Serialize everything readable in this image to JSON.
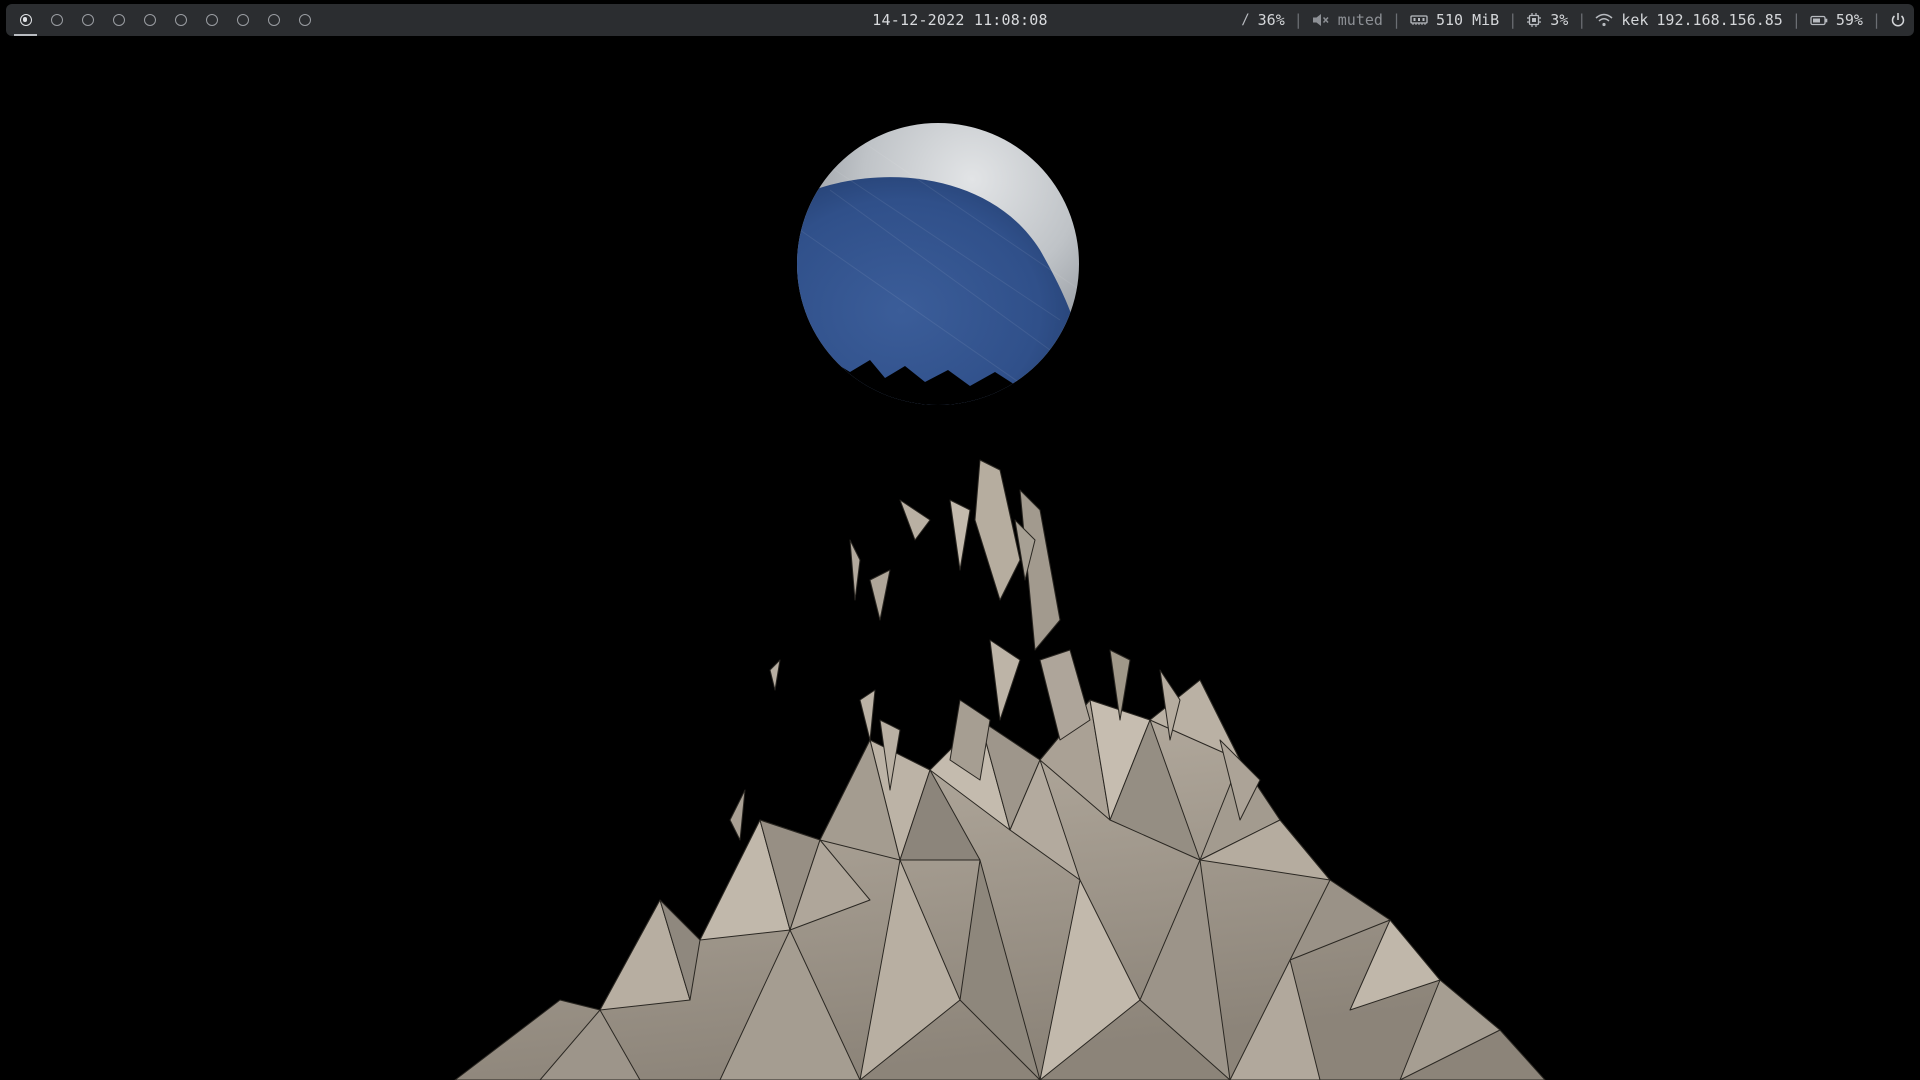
{
  "topbar": {
    "workspaces": [
      {
        "id": "1",
        "active": true
      },
      {
        "id": "2",
        "active": false
      },
      {
        "id": "3",
        "active": false
      },
      {
        "id": "4",
        "active": false
      },
      {
        "id": "5",
        "active": false
      },
      {
        "id": "6",
        "active": false
      },
      {
        "id": "7",
        "active": false
      },
      {
        "id": "8",
        "active": false
      },
      {
        "id": "9",
        "active": false
      },
      {
        "id": "10",
        "active": false
      }
    ],
    "clock": "14-12-2022 11:08:08",
    "disk": {
      "icon": "slash-disk-icon",
      "value": "36%"
    },
    "volume": {
      "icon": "speaker-muted-icon",
      "value": "muted"
    },
    "memory": {
      "icon": "memory-chip-icon",
      "value": "510 MiB"
    },
    "cpu": {
      "icon": "cpu-icon",
      "value": "3%"
    },
    "network": {
      "icon": "wifi-icon",
      "ssid": "kek",
      "ip": "192.168.156.85"
    },
    "battery": {
      "icon": "battery-icon",
      "value": "59%"
    },
    "power": {
      "icon": "power-icon"
    }
  },
  "colors": {
    "bar_bg": "#2b2d30",
    "bar_text": "#d4d6d9",
    "separator": "#6c6f74",
    "wallpaper_bg": "#000000",
    "moon_blue": "#34538a",
    "moon_grey": "#c9ccd0",
    "mountain": "#a89f93"
  },
  "wallpaper": {
    "moon": "moon-image",
    "mountain": "low-poly-mountain-image"
  }
}
